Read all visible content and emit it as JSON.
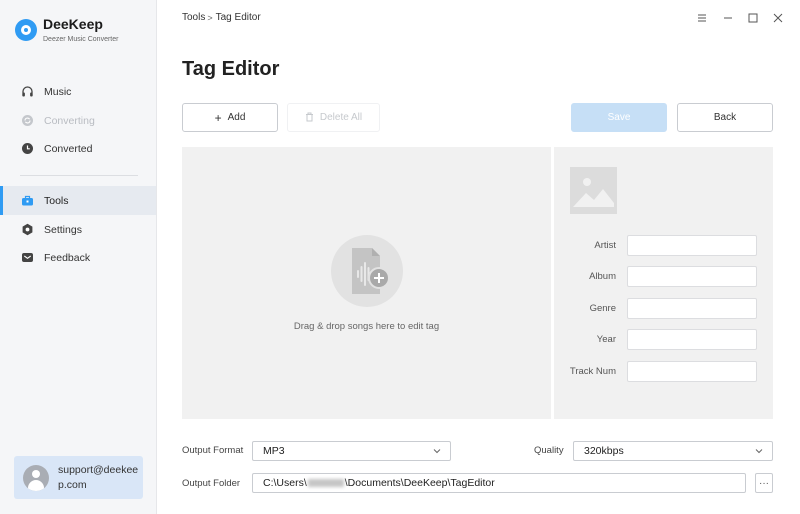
{
  "app": {
    "name": "DeeKeep",
    "subtitle": "Deezer Music Converter",
    "accent": "#2f9bf3"
  },
  "sidebar": {
    "items": [
      {
        "label": "Music",
        "icon": "headphones-icon",
        "state": "normal"
      },
      {
        "label": "Converting",
        "icon": "sync-icon",
        "state": "disabled"
      },
      {
        "label": "Converted",
        "icon": "clock-icon",
        "state": "normal"
      },
      {
        "label": "Tools",
        "icon": "toolbox-icon",
        "state": "active"
      },
      {
        "label": "Settings",
        "icon": "gear-icon",
        "state": "normal"
      },
      {
        "label": "Feedback",
        "icon": "mail-icon",
        "state": "normal"
      }
    ],
    "user_email": "support@deekeep.com"
  },
  "breadcrumb": {
    "parent": "Tools",
    "separator": ">",
    "current": "Tag Editor"
  },
  "page": {
    "title": "Tag Editor"
  },
  "toolbar": {
    "add_label": "Add",
    "delete_all_label": "Delete All",
    "save_label": "Save",
    "back_label": "Back"
  },
  "drop_zone": {
    "text": "Drag & drop songs here to edit tag"
  },
  "tags": {
    "fields": [
      {
        "label": "Artist",
        "value": ""
      },
      {
        "label": "Album",
        "value": ""
      },
      {
        "label": "Genre",
        "value": ""
      },
      {
        "label": "Year",
        "value": ""
      },
      {
        "label": "Track Num",
        "value": ""
      }
    ]
  },
  "output": {
    "format_label": "Output Format",
    "format_value": "MP3",
    "quality_label": "Quality",
    "quality_value": "320kbps",
    "folder_label": "Output Folder",
    "folder_prefix": "C:\\Users\\",
    "folder_suffix": "\\Documents\\DeeKeep\\TagEditor",
    "browse_label": "···"
  }
}
